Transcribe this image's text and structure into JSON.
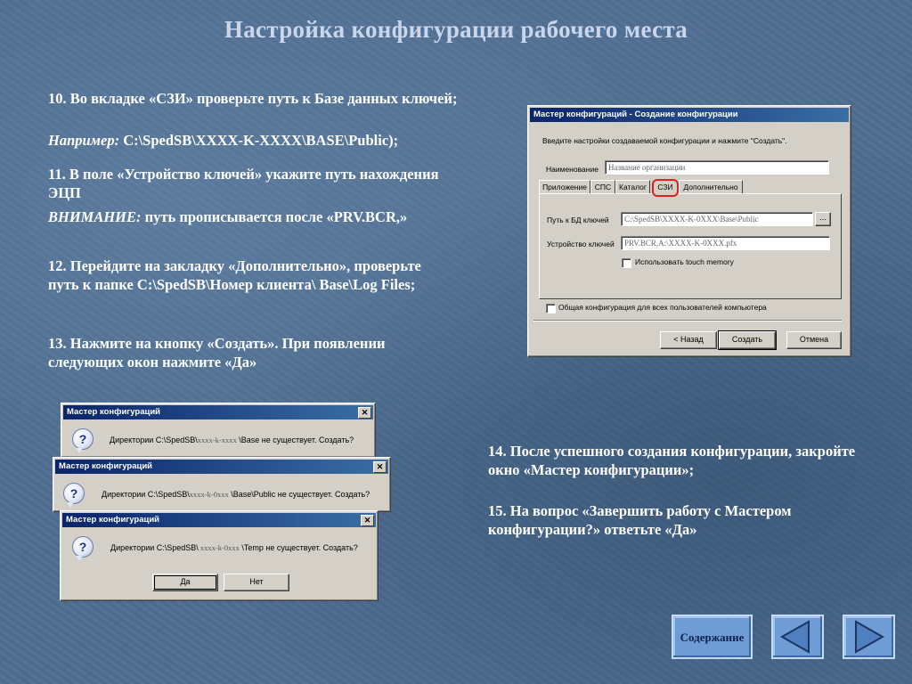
{
  "slide": {
    "title": "Настройка конфигурации рабочего места"
  },
  "steps": {
    "s10_line": "10. Во вкладке «СЗИ» проверьте путь к Базе данных ключей;",
    "s10_example_label": "Например:",
    "s10_example_value": " C:\\SpedSB\\XXXX-K-XXXX\\BASE\\Public);",
    "s11_line": "11. В поле «Устройство ключей» укажите путь нахождения ЭЦП",
    "s11_warning_label": "ВНИМАНИЕ:",
    "s11_warning_value": " путь прописывается после «PRV.BCR,»",
    "s12": "12.   Перейдите на закладку «Дополнительно», проверьте путь к папке C:\\SpedSB\\Номер клиента\\ Base\\Log Files;",
    "s13": "13.   Нажмите на кнопку «Создать». При появлении следующих окон нажмите «Да»",
    "s14": "14.   После успешного создания конфигурации, закройте окно «Мастер конфигурации»;",
    "s15": "15.   На вопрос «Завершить работу с Мастером конфигурации?» ответьте «Да»"
  },
  "config_dialog": {
    "title": "Мастер конфигураций - Создание конфигурации",
    "intro": "Введите настройки создаваемой конфигурации и нажмите \"Создать\".",
    "name_label": "Наименование",
    "name_value": "Название организации",
    "tabs": [
      "Приложение",
      "СПС",
      "Каталог",
      "СЗИ",
      "Дополнительно"
    ],
    "active_tab": "СЗИ",
    "db_path_label": "Путь к БД ключей",
    "db_path_value": "C:\\SpedSB\\XXXX-K-0XXX\\Base\\Public",
    "browse_label": "...",
    "key_device_label": "Устройство ключей",
    "key_device_value": "PRV.BCR,A:\\XXXX-K-0XXX.pfx",
    "touch_memory_label": "Использовать touch memory",
    "common_config_label": "Общая конфигурация для всех пользователей компьютера",
    "back_button": "< Назад",
    "create_button": "Создать",
    "cancel_button": "Отмена",
    "highlight_color": "#e0201c"
  },
  "msg_dialogs": [
    {
      "title": "Мастер конфигураций",
      "text_prefix": "Директории C:\\SpedSB\\",
      "text_path": "xxxx-k-xxxx",
      "text_suffix": " \\Base не существует. Создать?"
    },
    {
      "title": "Мастер конфигураций",
      "text_prefix": "Директории C:\\SpedSB\\",
      "text_path": "xxxx-k-0xxx",
      "text_suffix": " \\Base\\Public не существует. Создать?"
    },
    {
      "title": "Мастер конфигураций",
      "text_prefix": "Директории C:\\SpedSB\\",
      "text_path": " xxxx-k-0xxx",
      "text_suffix": " \\Temp не существует. Создать?",
      "yes_button": "Да",
      "no_button": "Нет"
    }
  ],
  "nav": {
    "contents_label": "Содержание",
    "prev_icon": "triangle-left-icon",
    "next_icon": "triangle-right-icon"
  }
}
